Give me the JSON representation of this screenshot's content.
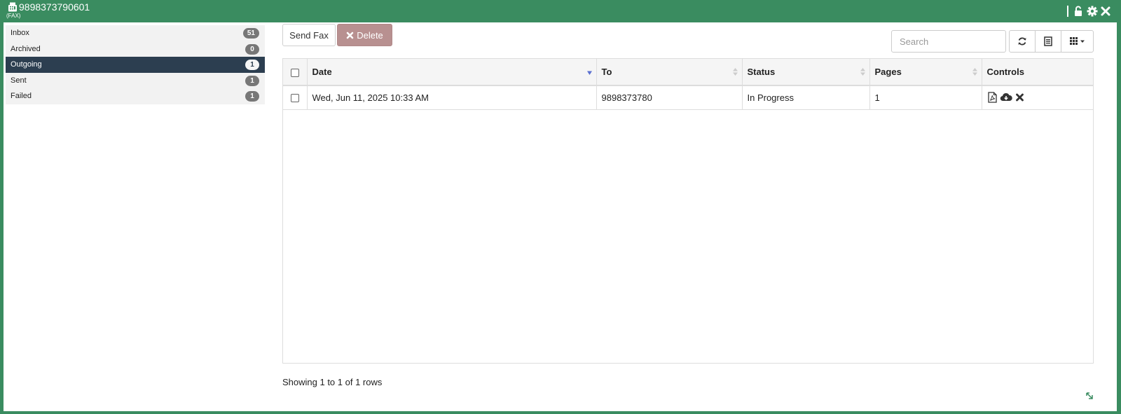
{
  "window": {
    "title": "9898373790601",
    "subtitle": "(FAX)",
    "icons": [
      "fax-icon",
      "unlock-icon",
      "gear-icon",
      "close-icon"
    ]
  },
  "sidebar": {
    "items": [
      {
        "label": "Inbox",
        "count": "51",
        "active": false
      },
      {
        "label": "Archived",
        "count": "0",
        "active": false
      },
      {
        "label": "Outgoing",
        "count": "1",
        "active": true
      },
      {
        "label": "Sent",
        "count": "1",
        "active": false
      },
      {
        "label": "Failed",
        "count": "1",
        "active": false
      }
    ]
  },
  "toolbar": {
    "send_fax_label": "Send Fax",
    "delete_label": "Delete",
    "search_placeholder": "Search",
    "icons": [
      "refresh-icon",
      "list-view-icon",
      "columns-icon"
    ]
  },
  "table": {
    "headers": {
      "date": "Date",
      "to": "To",
      "status": "Status",
      "pages": "Pages",
      "controls": "Controls"
    },
    "rows": [
      {
        "date": "Wed, Jun 11, 2025 10:33 AM",
        "to": "9898373780",
        "status": "In Progress",
        "pages": "1",
        "controls": [
          "pdf-icon",
          "cloud-download-icon",
          "delete-x-icon"
        ]
      }
    ]
  },
  "footer": {
    "pagination_text": "Showing 1 to 1 of 1 rows"
  },
  "colors": {
    "titlebar": "#3a8c60",
    "active_nav": "#2c3e50",
    "delete_button": "#b89090",
    "badge": "#777777"
  }
}
